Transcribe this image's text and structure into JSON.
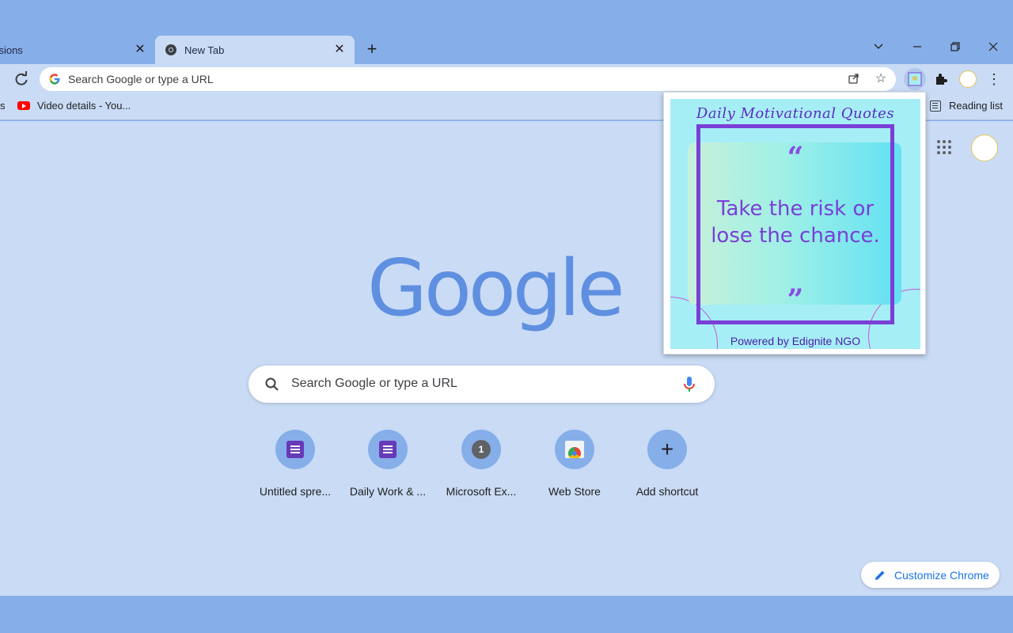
{
  "tabs": [
    {
      "label": "ensions",
      "active": false
    },
    {
      "label": "New Tab",
      "active": true
    }
  ],
  "window_controls": [
    "tab-search",
    "minimize",
    "restore",
    "close"
  ],
  "omnibox": {
    "text": "Search Google or type a URL"
  },
  "bookmarks": [
    {
      "label": "s"
    },
    {
      "label": "Video details - You..."
    }
  ],
  "reading_list": {
    "label": "Reading list"
  },
  "search": {
    "placeholder": "Search Google or type a URL"
  },
  "logo_text": "Google",
  "shortcuts": [
    {
      "label": "Untitled spre...",
      "icon": "sheet-icon"
    },
    {
      "label": "Daily Work & ...",
      "icon": "sheet-icon"
    },
    {
      "label": "Microsoft Ex...",
      "icon": "number-icon",
      "badge": "1"
    },
    {
      "label": "Web Store",
      "icon": "web-store-icon"
    },
    {
      "label": "Add shortcut",
      "icon": "plus-icon"
    }
  ],
  "customize": {
    "label": "Customize Chrome"
  },
  "popup": {
    "title": "Daily Motivational Quotes",
    "open_quote": "“",
    "quote_line1": "Take the risk or",
    "quote_line2": "lose the chance.",
    "close_quote": "”",
    "footer": "Powered by Edignite NGO"
  },
  "colors": {
    "frame": "#86aee9",
    "surface": "#c9dbf5",
    "accent": "#1a73e8",
    "popup_purple": "#7a3fd6",
    "popup_bg": "#a6eef6"
  }
}
